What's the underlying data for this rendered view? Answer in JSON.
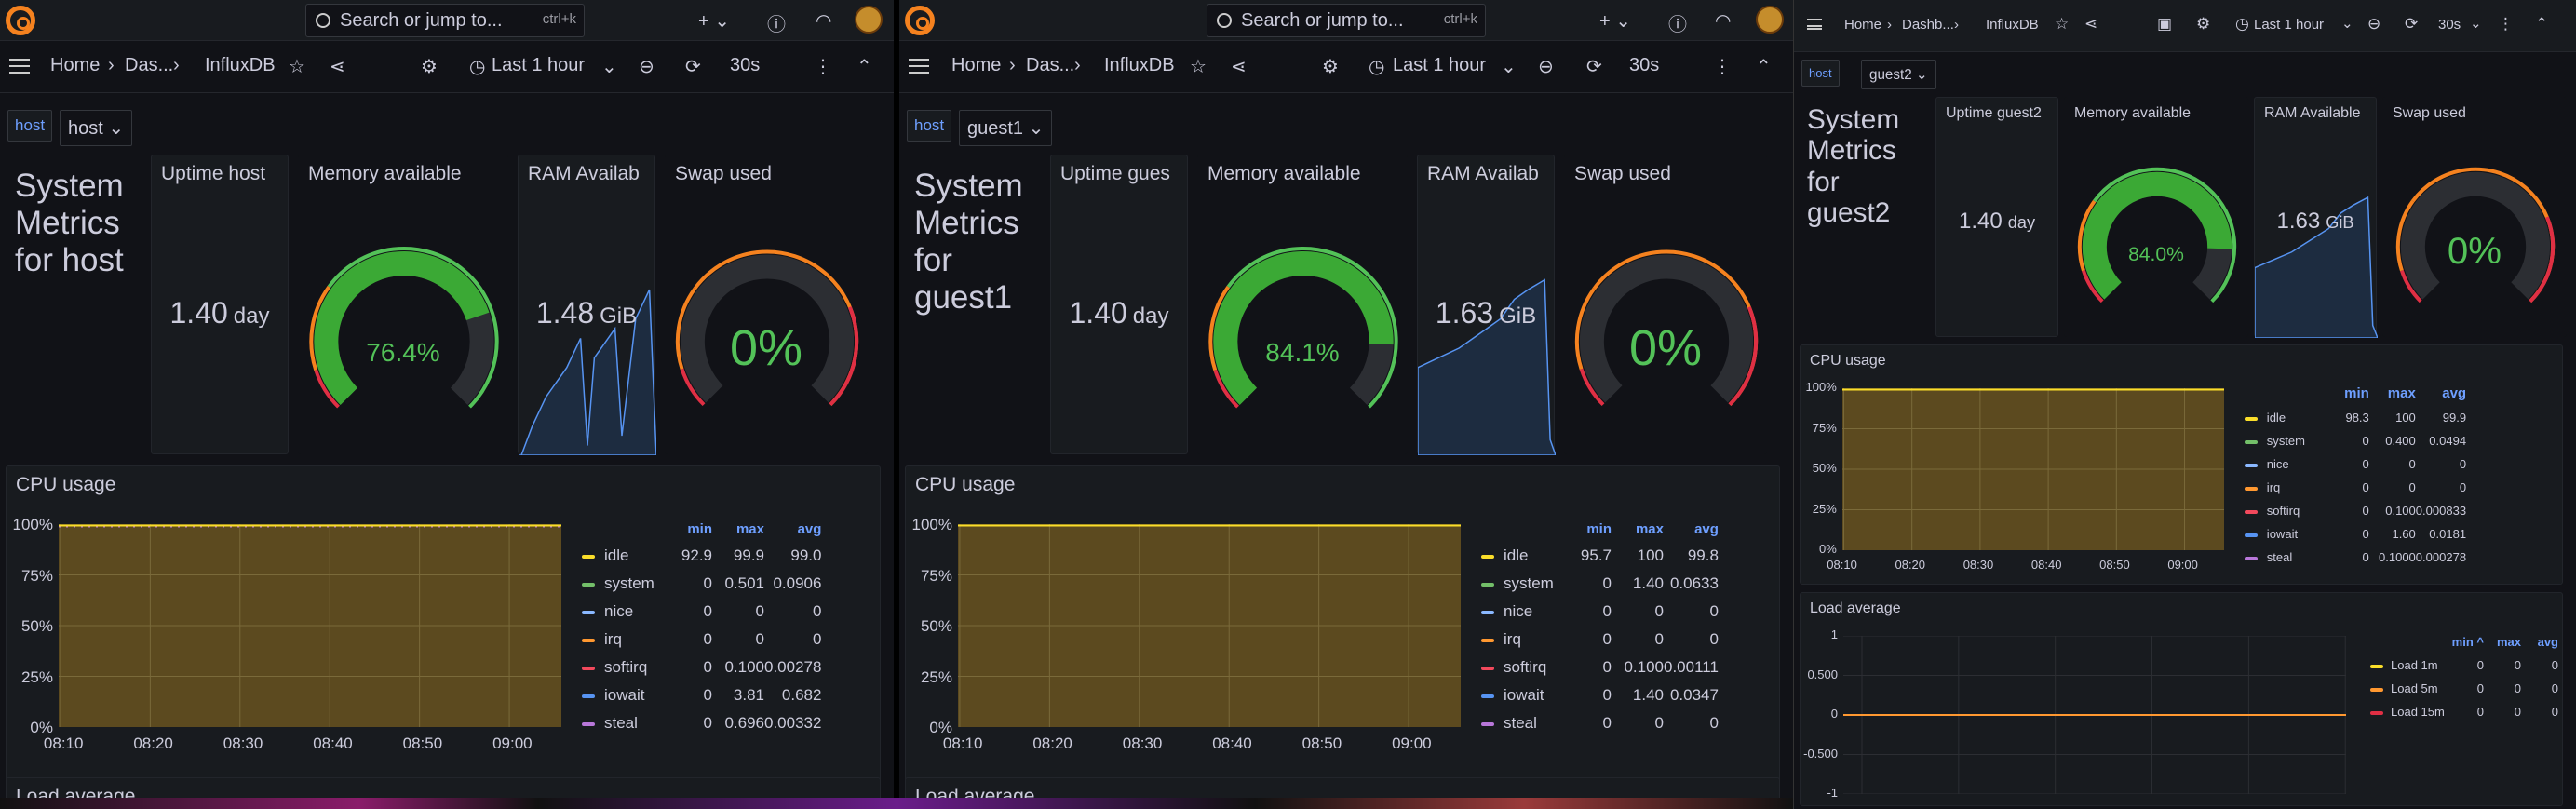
{
  "top": {
    "search_placeholder": "Search or jump to...",
    "shortcut": "ctrl+k"
  },
  "breadcrumb": {
    "home": "Home",
    "dashboards": "Das...",
    "dashboards_short": "Dashb...",
    "current": "InfluxDB"
  },
  "time": {
    "range": "Last 1 hour",
    "refresh": "30s"
  },
  "colors": {
    "accent": "#6e9fff",
    "green": "#53c258",
    "orange": "#f5821f",
    "red": "#e02f44",
    "chart_fill": "#5c4a1f",
    "sparkline": "#5794f2"
  },
  "icons": [
    "grafana-logo-icon",
    "search-icon",
    "plus-icon",
    "help-icon",
    "rss-icon",
    "avatar",
    "menu-icon",
    "star-icon",
    "share-icon",
    "gear-icon",
    "clock-icon",
    "zoom-out-icon",
    "refresh-icon",
    "more-icon",
    "collapse-icon",
    "save-icon"
  ],
  "windows": [
    {
      "var_label": "host",
      "var_value": "host",
      "title": "System Metrics for host",
      "uptime_title": "Uptime host",
      "uptime_value": "1.40",
      "uptime_unit": "day",
      "mem_title": "Memory available",
      "mem_value": "76.4%",
      "ram_title": "RAM Availab",
      "ram_value": "1.48",
      "ram_unit": "GiB",
      "swap_title": "Swap used",
      "swap_value": "0%",
      "cpu_title": "CPU usage",
      "load_title": "Load average",
      "legend": [
        [
          "idle",
          "92.9",
          "99.9",
          "99.0"
        ],
        [
          "system",
          "0",
          "0.501",
          "0.0906"
        ],
        [
          "nice",
          "0",
          "0",
          "0"
        ],
        [
          "irq",
          "0",
          "0",
          "0"
        ],
        [
          "softirq",
          "0",
          "0.100",
          "0.00278"
        ],
        [
          "iowait",
          "0",
          "3.81",
          "0.682"
        ],
        [
          "steal",
          "0",
          "0.696",
          "0.00332"
        ]
      ]
    },
    {
      "var_label": "host",
      "var_value": "guest1",
      "title": "System Metrics for guest1",
      "uptime_title": "Uptime gues",
      "uptime_value": "1.40",
      "uptime_unit": "day",
      "mem_title": "Memory available",
      "mem_value": "84.1%",
      "ram_title": "RAM Availab",
      "ram_value": "1.63",
      "ram_unit": "GiB",
      "swap_title": "Swap used",
      "swap_value": "0%",
      "cpu_title": "CPU usage",
      "load_title": "Load average",
      "legend": [
        [
          "idle",
          "95.7",
          "100",
          "99.8"
        ],
        [
          "system",
          "0",
          "1.40",
          "0.0633"
        ],
        [
          "nice",
          "0",
          "0",
          "0"
        ],
        [
          "irq",
          "0",
          "0",
          "0"
        ],
        [
          "softirq",
          "0",
          "0.100",
          "0.00111"
        ],
        [
          "iowait",
          "0",
          "1.40",
          "0.0347"
        ],
        [
          "steal",
          "0",
          "0",
          "0"
        ]
      ]
    },
    {
      "var_label": "host",
      "var_value": "guest2",
      "title": "System Metrics for guest2",
      "uptime_title": "Uptime guest2",
      "uptime_value": "1.40",
      "uptime_unit": "day",
      "mem_title": "Memory available",
      "mem_value": "84.0%",
      "ram_title": "RAM Available",
      "ram_value": "1.63",
      "ram_unit": "GiB",
      "swap_title": "Swap used",
      "swap_value": "0%",
      "cpu_title": "CPU usage",
      "load_title": "Load average",
      "legend": [
        [
          "idle",
          "98.3",
          "100",
          "99.9"
        ],
        [
          "system",
          "0",
          "0.400",
          "0.0494"
        ],
        [
          "nice",
          "0",
          "0",
          "0"
        ],
        [
          "irq",
          "0",
          "0",
          "0"
        ],
        [
          "softirq",
          "0",
          "0.100",
          "0.000833"
        ],
        [
          "iowait",
          "0",
          "1.60",
          "0.0181"
        ],
        [
          "steal",
          "0",
          "0.1000",
          "0.000278"
        ]
      ],
      "load_legend": [
        [
          "Load 1m",
          "0",
          "0",
          "0"
        ],
        [
          "Load 5m",
          "0",
          "0",
          "0"
        ],
        [
          "Load 15m",
          "0",
          "0",
          "0"
        ]
      ]
    }
  ],
  "legend_headers": {
    "min": "min",
    "max": "max",
    "avg": "avg",
    "min_sorted": "min ^"
  },
  "series_colors": {
    "idle": "#fade2a",
    "system": "#73bf69",
    "nice": "#8ab8ff",
    "irq": "#ff9830",
    "softirq": "#f2495c",
    "iowait": "#5794f2",
    "steal": "#b877d9",
    "Load 1m": "#fade2a",
    "Load 5m": "#ff9830",
    "Load 15m": "#e02f44"
  },
  "chart_data": [
    {
      "type": "area",
      "title": "CPU usage",
      "x": [
        "08:10",
        "08:20",
        "08:30",
        "08:40",
        "08:50",
        "09:00"
      ],
      "y_ticks": [
        "100%",
        "75%",
        "50%",
        "25%",
        "0%"
      ],
      "ylim": [
        0,
        100
      ],
      "series": [
        {
          "name": "idle",
          "values": [
            99,
            99,
            99,
            99,
            99,
            99
          ]
        }
      ]
    },
    {
      "type": "line",
      "title": "Load average",
      "y_ticks": [
        "1",
        "0.500",
        "0",
        "-0.500",
        "-1"
      ],
      "ylim": [
        -1,
        1
      ],
      "series": [
        {
          "name": "Load 1m",
          "values": [
            0,
            0,
            0,
            0,
            0,
            0
          ]
        },
        {
          "name": "Load 5m",
          "values": [
            0,
            0,
            0,
            0,
            0,
            0
          ]
        },
        {
          "name": "Load 15m",
          "values": [
            0,
            0,
            0,
            0,
            0,
            0
          ]
        }
      ]
    }
  ]
}
